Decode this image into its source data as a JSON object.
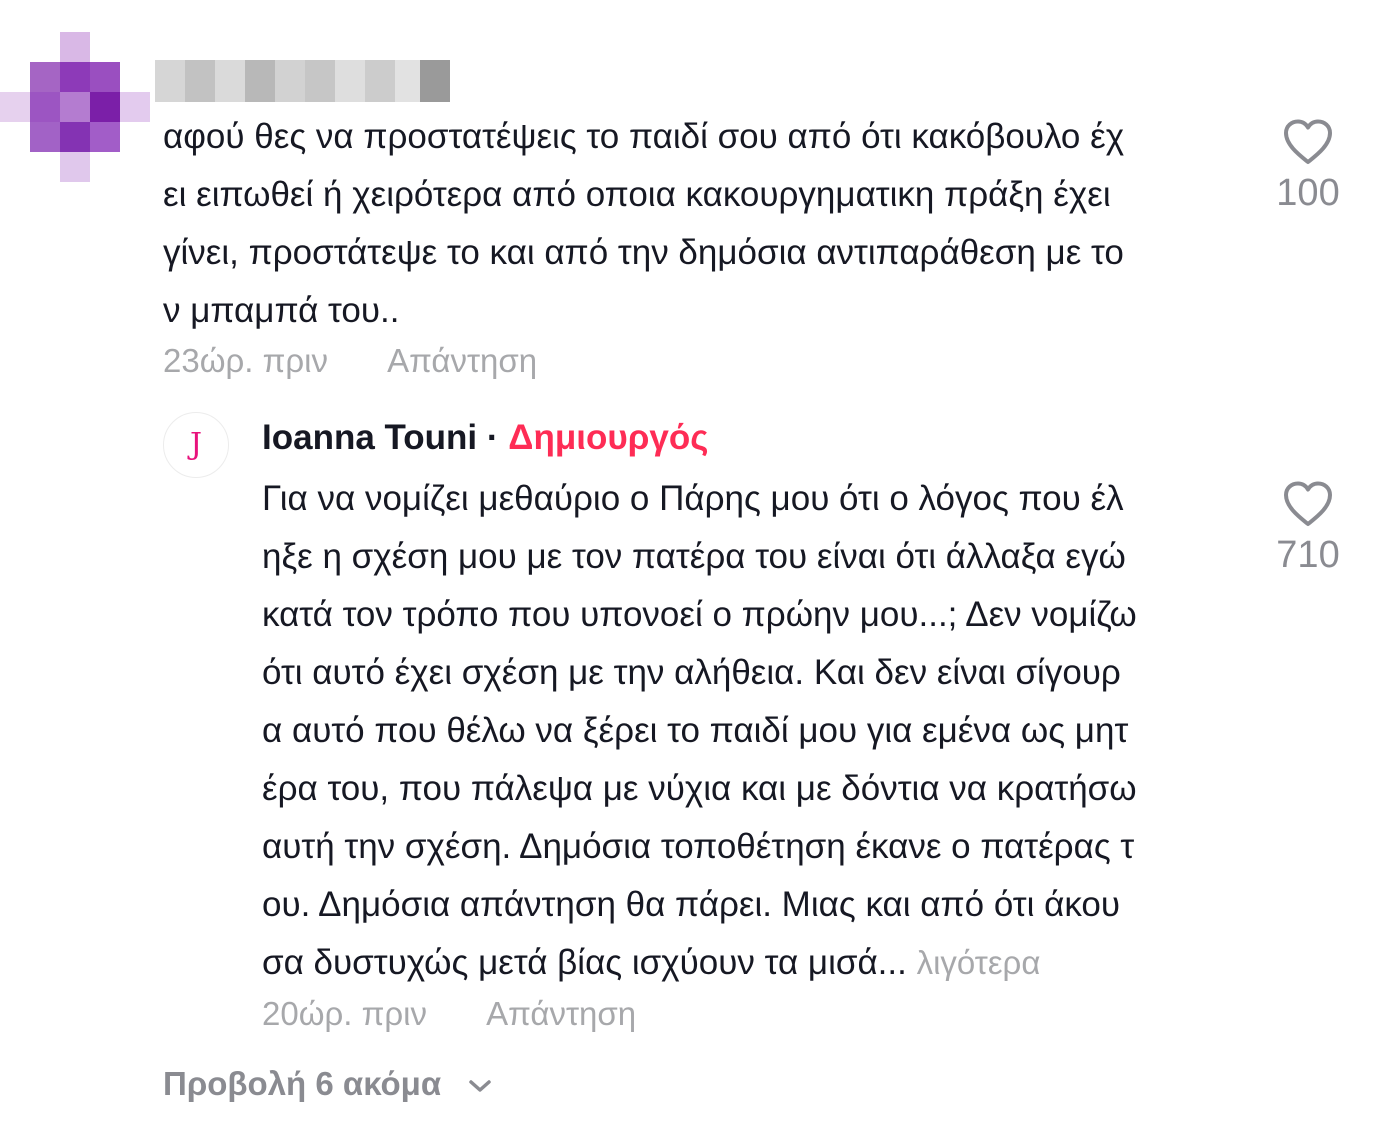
{
  "colors": {
    "text": "#161823",
    "meta": "#a7a8ab",
    "creator_badge": "#fe2c55",
    "like_count": "#8a8b91"
  },
  "comments": [
    {
      "username": "",
      "text": "αφού θες να προστατέψεις το παιδί σου από ότι κακόβουλο έχ\nει ειπωθεί ή χειρότερα από οποια κακουργηματικη πράξη έχει\nγίνει, προστάτεψε το και από την δημόσια αντιπαράθεση με το\nν μπαμπά του..",
      "time": "23ώρ. πριν",
      "reply_label": "Απάντηση",
      "likes": "100",
      "like_icon": "heart-outline-icon"
    }
  ],
  "reply": {
    "avatar_letter": "J",
    "username": "Ioanna Touni",
    "separator": "·",
    "badge": "Δημιουργός",
    "text": "Για να νομίζει μεθαύριο ο Πάρης μου ότι ο λόγος που έλ\nηξε η σχέση μου με τον πατέρα του είναι ότι άλλαξα εγώ\nκατά τον τρόπο που υπονοεί ο πρώην μου...; Δεν νομίζω\nότι αυτό έχει σχέση με την αλήθεια. Και δεν είναι σίγουρ\nα αυτό που θέλω να ξέρει το παιδί μου για εμένα ως μητ\nέρα του, που πάλεψα με νύχια και με δόντια να κρατήσω\nαυτή την σχέση. Δημόσια τοποθέτηση έκανε ο πατέρας τ\nου. Δημόσια απάντηση θα πάρει. Μιας και από ότι άκου\nσα δυστυχώς μετά βίας ισχύουν τα μισά...",
    "less_label": "λιγότερα",
    "time": "20ώρ. πριν",
    "reply_label": "Απάντηση",
    "likes": "710",
    "like_icon": "heart-outline-icon"
  },
  "view_more": {
    "label": "Προβολή 6 ακόμα",
    "icon": "chevron-down-icon"
  }
}
